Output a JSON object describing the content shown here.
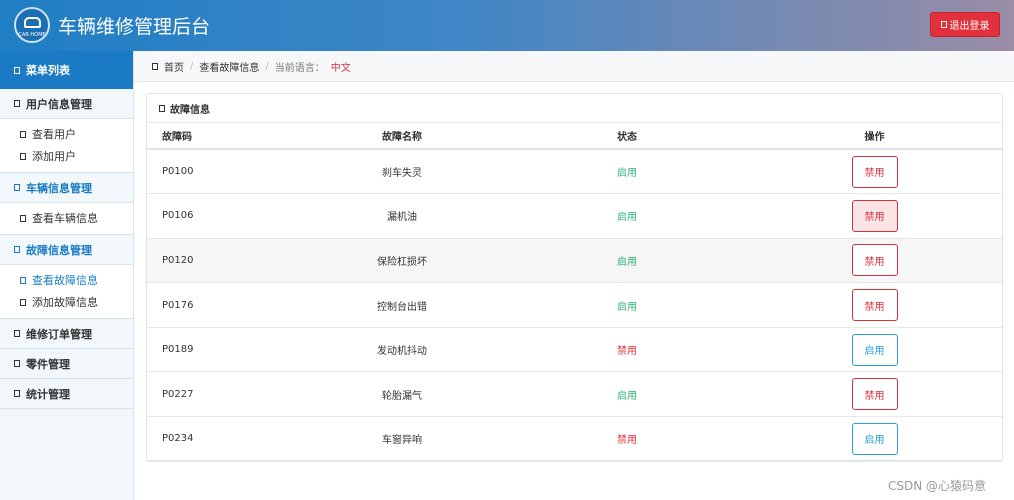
{
  "header": {
    "logo_text": "CAR HOME",
    "title": "车辆维修管理后台",
    "logout_label": "退出登录"
  },
  "sidebar": {
    "menu_title": "菜单列表",
    "groups": [
      {
        "label": "用户信息管理",
        "items": [
          "查看用户",
          "添加用户"
        ]
      },
      {
        "label": "车辆信息管理",
        "items": [
          "查看车辆信息"
        ]
      },
      {
        "label": "故障信息管理",
        "items": [
          "查看故障信息",
          "添加故障信息"
        ]
      },
      {
        "label": "维修订单管理"
      },
      {
        "label": "零件管理"
      },
      {
        "label": "统计管理"
      }
    ]
  },
  "breadcrumb": {
    "home": "首页",
    "current": "查看故障信息",
    "lang_label": "当前语言：",
    "lang_value": "中文"
  },
  "panel": {
    "title": "故障信息",
    "columns": [
      "故障码",
      "故障名称",
      "状态",
      "操作"
    ],
    "rows": [
      {
        "code": "P0100",
        "name": "刹车失灵",
        "status": "启用",
        "action": "禁用"
      },
      {
        "code": "P0106",
        "name": "漏机油",
        "status": "启用",
        "action": "禁用"
      },
      {
        "code": "P0120",
        "name": "保险杠损坏",
        "status": "启用",
        "action": "禁用"
      },
      {
        "code": "P0176",
        "name": "控制台出错",
        "status": "启用",
        "action": "禁用"
      },
      {
        "code": "P0189",
        "name": "发动机抖动",
        "status": "禁用",
        "action": "启用"
      },
      {
        "code": "P0227",
        "name": "轮胎漏气",
        "status": "启用",
        "action": "禁用"
      },
      {
        "code": "P0234",
        "name": "车窗异响",
        "status": "禁用",
        "action": "启用"
      }
    ]
  },
  "watermark": "CSDN @心猿码意",
  "colors": {
    "primary": "#1a7bc4",
    "danger": "#e2303c",
    "success": "#2bb673",
    "info": "#2a9fd8"
  }
}
